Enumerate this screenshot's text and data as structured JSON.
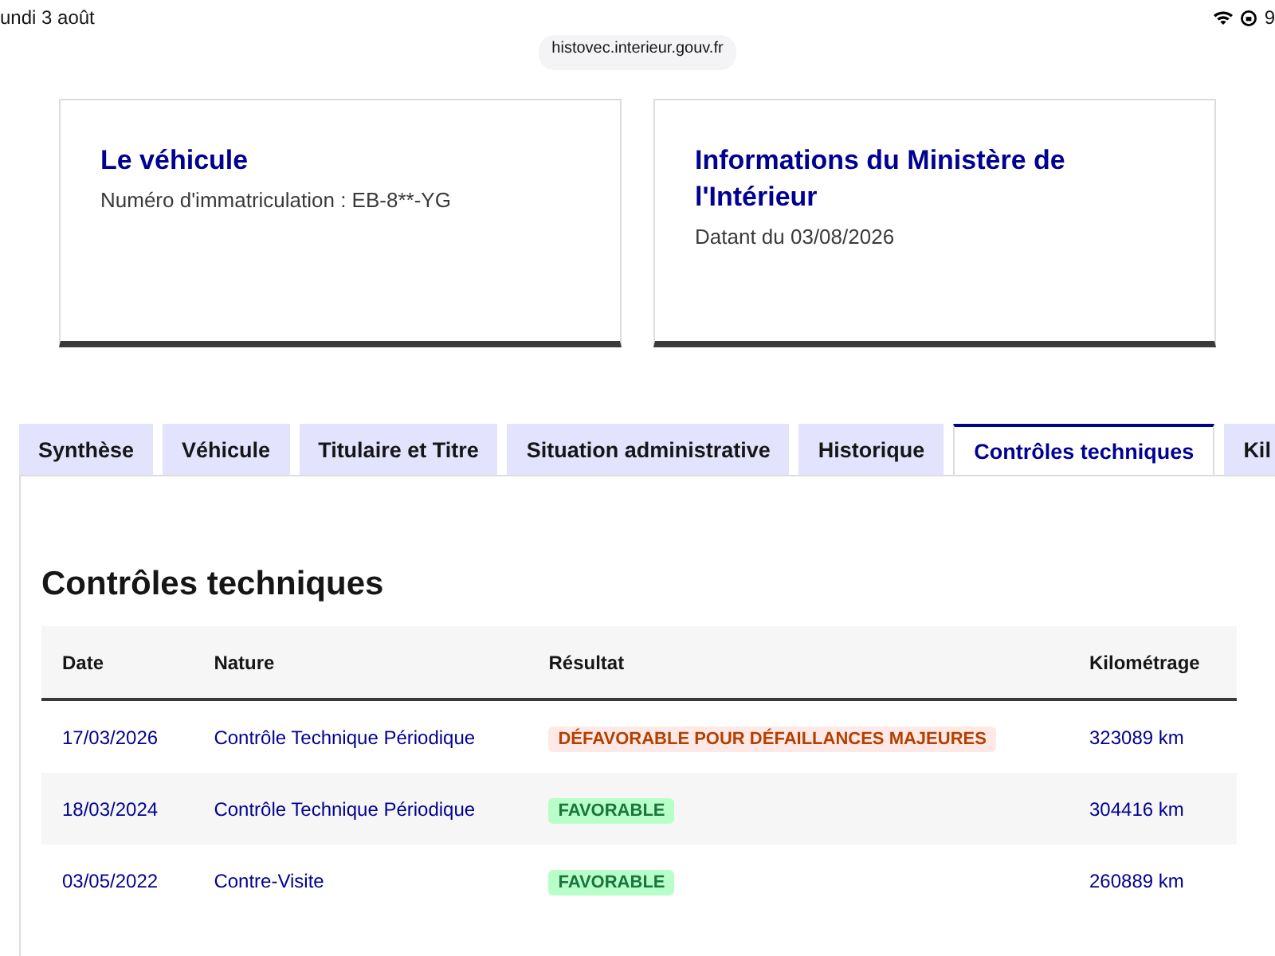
{
  "status_bar": {
    "date": "undi 3 août",
    "battery": "9"
  },
  "address_bar": {
    "url": "histovec.interieur.gouv.fr"
  },
  "cards": [
    {
      "title": "Le véhicule",
      "text": "Numéro d'immatriculation : EB-8**-YG"
    },
    {
      "title": "Informations du Ministère de l'Intérieur",
      "text": "Datant du 03/08/2026"
    }
  ],
  "tabs": [
    {
      "label": "Synthèse",
      "selected": false
    },
    {
      "label": "Véhicule",
      "selected": false
    },
    {
      "label": "Titulaire et Titre",
      "selected": false
    },
    {
      "label": "Situation administrative",
      "selected": false
    },
    {
      "label": "Historique",
      "selected": false
    },
    {
      "label": "Contrôles techniques",
      "selected": true
    },
    {
      "label": "Kil",
      "selected": false
    }
  ],
  "section_title": "Contrôles techniques",
  "table": {
    "columns": [
      "Date",
      "Nature",
      "Résultat",
      "Kilométrage"
    ],
    "rows": [
      {
        "date": "17/03/2026",
        "nature": "Contrôle Technique Périodique",
        "result": {
          "label": "DÉFAVORABLE POUR DÉFAILLANCES MAJEURES",
          "kind": "error"
        },
        "mileage": "323089 km"
      },
      {
        "date": "18/03/2024",
        "nature": "Contrôle Technique Périodique",
        "result": {
          "label": "FAVORABLE",
          "kind": "success"
        },
        "mileage": "304416 km"
      },
      {
        "date": "03/05/2022",
        "nature": "Contre-Visite",
        "result": {
          "label": "FAVORABLE",
          "kind": "success"
        },
        "mileage": "260889 km"
      }
    ]
  }
}
